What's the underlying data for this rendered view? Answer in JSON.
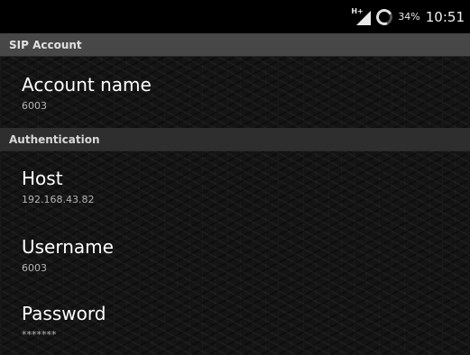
{
  "status_bar": {
    "network": "H+",
    "network_icon": "signal-icon",
    "battery_icon": "battery-ring-icon",
    "battery_percent": "34%",
    "time": "10:51"
  },
  "sections": {
    "sip_account": "SIP Account",
    "authentication": "Authentication"
  },
  "prefs": {
    "account_name": {
      "title": "Account name",
      "summary": "6003"
    },
    "host": {
      "title": "Host",
      "summary": "192.168.43.82"
    },
    "username": {
      "title": "Username",
      "summary": "6003"
    },
    "password": {
      "title": "Password",
      "summary": "*******"
    }
  },
  "colors": {
    "status_bar_bg": "#000000",
    "header_bg": "#474747",
    "title_text": "#ffffff",
    "summary_text": "#b4b4b4"
  }
}
